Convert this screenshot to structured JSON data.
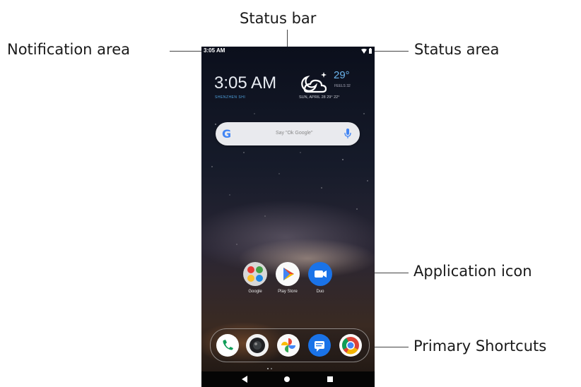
{
  "callouts": {
    "status_bar": "Status bar",
    "notification_area": "Notification area",
    "status_area": "Status area",
    "application_icon": "Application icon",
    "primary_shortcuts": "Primary Shortcuts"
  },
  "phone": {
    "status_time": "3:05 AM",
    "clock": "3:05 AM",
    "city": "SHENZHEN SHI",
    "weather": {
      "icon": "partly-cloudy-night-icon",
      "temp": "29°",
      "subtitle": "FEELS 32",
      "date": "SUN, APRIL 28  29° 22°"
    },
    "search": {
      "placeholder": "Say \"Ok Google\""
    },
    "apps": [
      {
        "label": "Google",
        "icon": "google-folder-icon"
      },
      {
        "label": "Play Store",
        "icon": "play-store-icon"
      },
      {
        "label": "Duo",
        "icon": "duo-icon"
      }
    ],
    "dock": [
      {
        "icon": "phone-icon"
      },
      {
        "icon": "camera-icon"
      },
      {
        "icon": "photos-icon"
      },
      {
        "icon": "messages-icon"
      },
      {
        "icon": "chrome-icon"
      }
    ],
    "nav": [
      "back-icon",
      "home-icon",
      "recents-icon"
    ]
  },
  "colors": {
    "clock_city": "#4fa3e0",
    "temp": "#6bb4ec",
    "duo": "#1a73e8",
    "phone": "#ffffff",
    "messages": "#1a73e8"
  }
}
